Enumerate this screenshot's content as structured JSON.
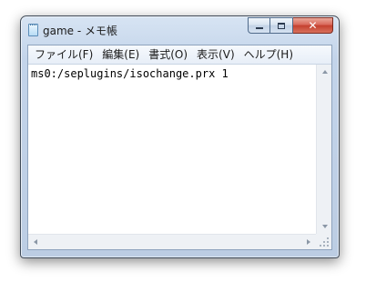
{
  "window": {
    "title": "game - メモ帳",
    "close_glyph": "✕"
  },
  "menu": {
    "items": [
      {
        "label": "ファイル(F)"
      },
      {
        "label": "編集(E)"
      },
      {
        "label": "書式(O)"
      },
      {
        "label": "表示(V)"
      },
      {
        "label": "ヘルプ(H)"
      }
    ]
  },
  "editor": {
    "content": "ms0:/seplugins/isochange.prx 1"
  },
  "icons": {
    "app": "notepad-icon",
    "minimize": "minimize-icon",
    "maximize": "maximize-icon",
    "close": "close-icon"
  }
}
